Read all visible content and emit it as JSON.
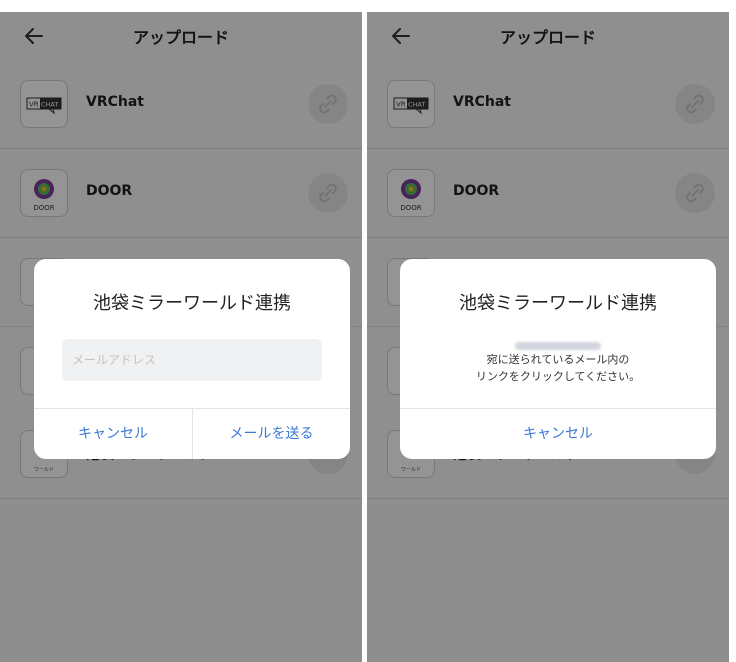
{
  "header": {
    "title": "アップロード"
  },
  "items": [
    {
      "label": "VRChat"
    },
    {
      "label": "DOOR"
    },
    {
      "label": "池袋ミラーワールド"
    }
  ],
  "dialog_left": {
    "title": "池袋ミラーワールド連携",
    "email_placeholder": "メールアドレス",
    "cancel_label": "キャンセル",
    "send_label": "メールを送る"
  },
  "dialog_right": {
    "title": "池袋ミラーワールド連携",
    "message_line1": "宛に送られているメール内の",
    "message_line2": "リンクをクリックしてください。",
    "cancel_label": "キャンセル"
  },
  "colors": {
    "accent": "#3b78d8"
  },
  "icons": [
    "back-arrow-icon",
    "vrchat-logo",
    "door-logo",
    "ikebukuro-logo",
    "link-icon"
  ]
}
